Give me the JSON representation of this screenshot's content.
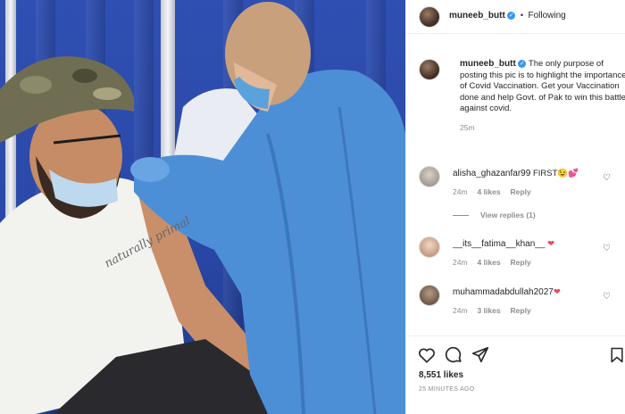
{
  "post": {
    "author": "muneeb_butt",
    "follow_status": "Following",
    "caption": "The only purpose of posting this pic is to highlight the importance of Covid Vaccination. Get your Vaccination done and help Govt. of Pak to win this battle against covid.",
    "caption_time": "25m",
    "likes": "8,551 likes",
    "posted_ago": "25 MINUTES AGO",
    "shirt_text": "naturally primal"
  },
  "comments": [
    {
      "user": "alisha_ghazanfar99",
      "text": "FIRST",
      "emoji": "😉💕",
      "time": "24m",
      "likes": "4 likes",
      "reply": "Reply"
    },
    {
      "user": "__its__fatima__khan__",
      "text": "",
      "emoji": "❤",
      "time": "24m",
      "likes": "4 likes",
      "reply": "Reply"
    },
    {
      "user": "muhammadabdullah2027",
      "text": "",
      "emoji": "❤",
      "time": "24m",
      "likes": "3 likes",
      "reply": "Reply"
    }
  ],
  "view_replies": "View replies (1)",
  "icons": {
    "verified": "verified-badge-icon",
    "heart": "heart-icon",
    "comment": "comment-icon",
    "share": "share-icon",
    "save": "bookmark-icon"
  },
  "colors": {
    "verified": "#3897f0",
    "muted": "#8e8e8e",
    "text": "#262626",
    "curtain": "#2a48a8",
    "gown": "#4d8fd6"
  }
}
